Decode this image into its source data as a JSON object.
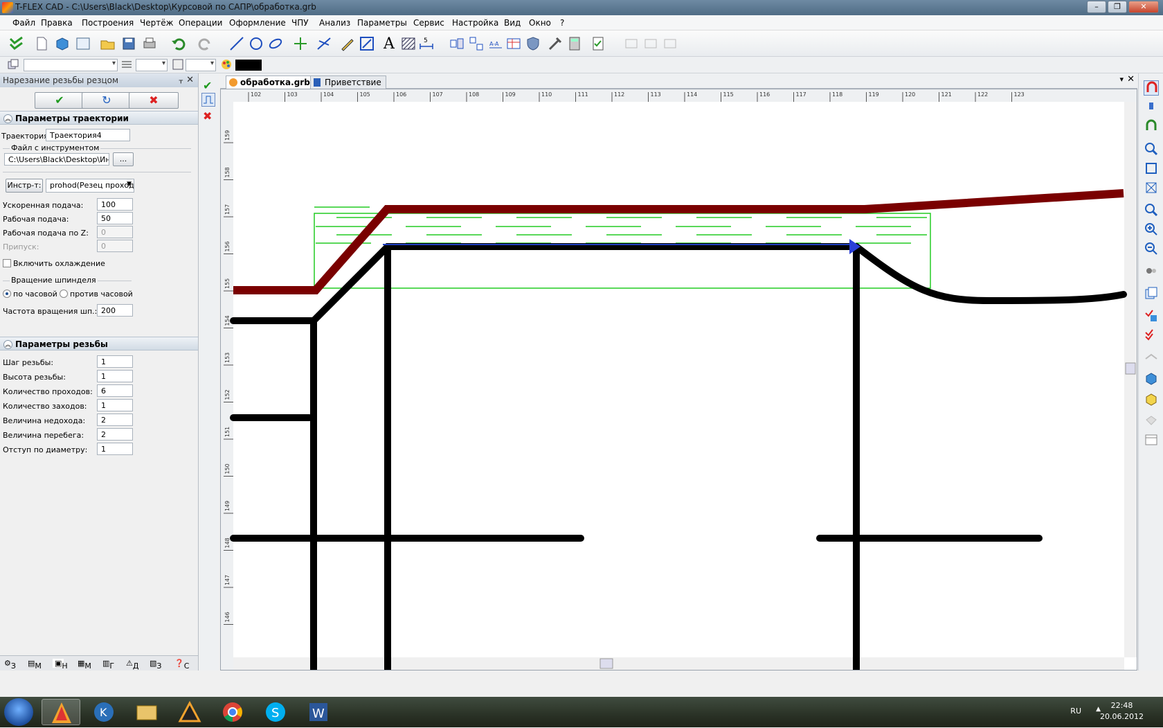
{
  "window": {
    "title": "T-FLEX CAD - C:\\Users\\Black\\Desktop\\Курсовой по САПР\\обработка.grb",
    "min": "–",
    "max": "❐",
    "close": "✕"
  },
  "menu": [
    "Файл",
    "Правка",
    "Построения",
    "Чертёж",
    "Операции",
    "Оформление",
    "ЧПУ",
    "Анализ",
    "Параметры",
    "Сервис",
    "Настройка",
    "Вид",
    "Окно",
    "?"
  ],
  "panel": {
    "title": "Нарезание резьбы резцом",
    "pin": "ᚁ",
    "close": "✕",
    "ok": "✔",
    "refresh": "↻",
    "cancel": "✖",
    "traj_section": "Параметры траектории",
    "traj_label": "Траектория:",
    "traj_value": "Траектория4",
    "file_group": "Файл с инструментом",
    "file_value": "C:\\Users\\Black\\Desktop\\Инстр",
    "browse": "...",
    "tool_btn": "Инстр-т:",
    "tool_value": "prohod(Резец проход",
    "fast_feed_label": "Ускоренная подача:",
    "fast_feed": "100",
    "work_feed_label": "Рабочая подача:",
    "work_feed": "50",
    "work_feed_z_label": "Рабочая подача по Z:",
    "work_feed_z": "0",
    "allowance_label": "Припуск:",
    "allowance": "0",
    "cooling_label": "Включить охлаждение",
    "spindle_group": "Вращение шпинделя",
    "cw_label": "по часовой",
    "ccw_label": "против часовой",
    "speed_label": "Частота вращения шп.:",
    "speed": "200",
    "thread_section": "Параметры резьбы",
    "thread_rows": [
      {
        "label": "Шаг резьбы:",
        "value": "1"
      },
      {
        "label": "Высота резьбы:",
        "value": "1"
      },
      {
        "label": "Количество проходов:",
        "value": "6"
      },
      {
        "label": "Количество заходов:",
        "value": "1"
      },
      {
        "label": "Величина недохода:",
        "value": "2"
      },
      {
        "label": "Величина перебега:",
        "value": "2"
      },
      {
        "label": "Отступ по диаметру:",
        "value": "1"
      }
    ],
    "bottom_tabs": [
      "З",
      "М",
      "Н",
      "М",
      "Г",
      "Д",
      "З",
      "С"
    ]
  },
  "doc_tabs": [
    "обработка.grb",
    "Приветствие"
  ],
  "ruler_top": [
    "102",
    "103",
    "104",
    "105",
    "106",
    "107",
    "108",
    "109",
    "110",
    "111",
    "112",
    "113",
    "114",
    "115",
    "116",
    "117",
    "118",
    "119",
    "120",
    "121",
    "122",
    "123"
  ],
  "ruler_left": [
    "159",
    "158",
    "157",
    "156",
    "155",
    "154",
    "153",
    "152",
    "151",
    "150",
    "149",
    "148",
    "147",
    "146"
  ],
  "colors": {
    "profile": "#7a0000",
    "part": "#000000",
    "toolpath": "#22cc22",
    "accent": "#1f5fbf"
  },
  "taskbar": {
    "lang": "RU",
    "time": "22:48",
    "date": "20.06.2012"
  }
}
